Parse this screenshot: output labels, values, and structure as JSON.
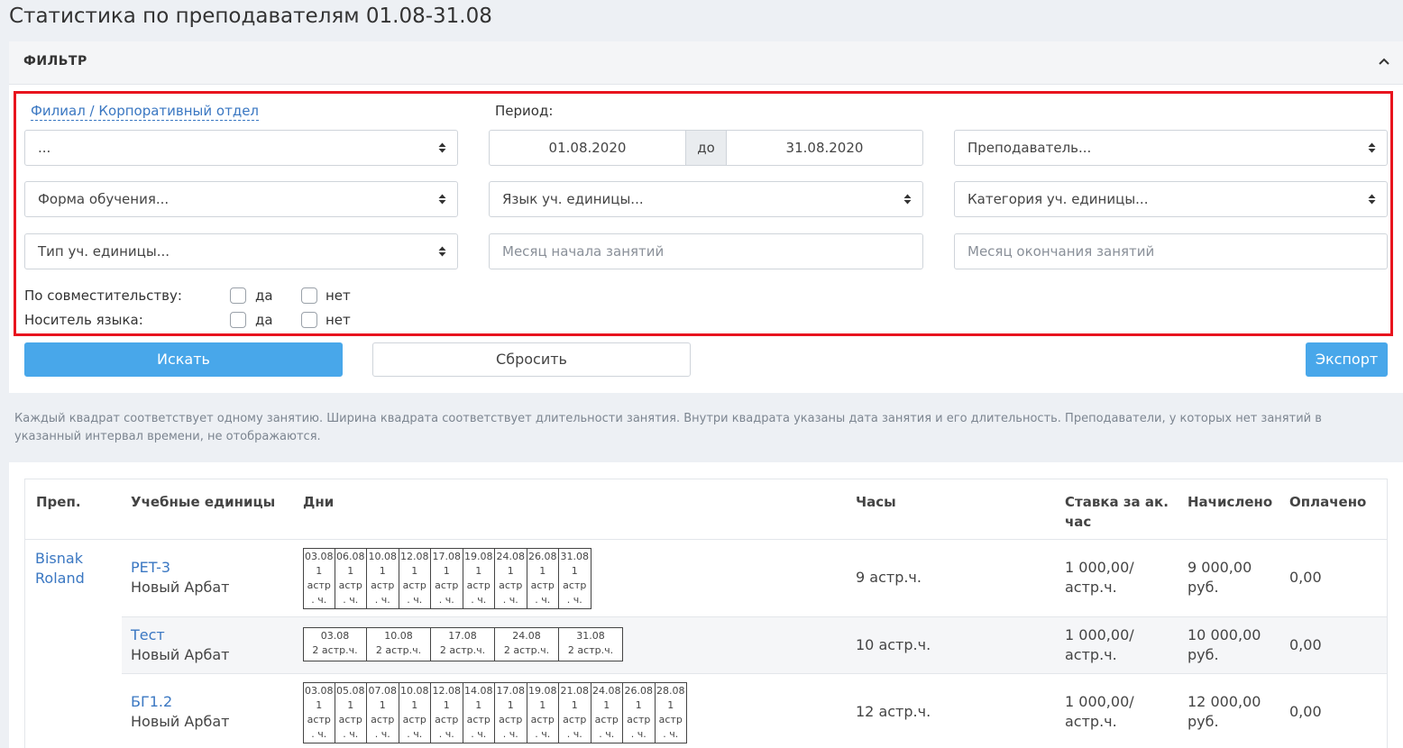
{
  "page_title": "Статистика по преподавателям 01.08-31.08",
  "filter": {
    "title": "ФИЛЬТР",
    "branch_link": "Филиал / Корпоративный отдел",
    "branch_value": "...",
    "period_label": "Период:",
    "date_from": "01.08.2020",
    "date_sep": "до",
    "date_to": "31.08.2020",
    "teacher": "Преподаватель...",
    "study_form": "Форма обучения...",
    "unit_language": "Язык уч. единицы...",
    "unit_category": "Категория уч. единицы...",
    "unit_type": "Тип уч. единицы...",
    "month_start_placeholder": "Месяц начала занятий",
    "month_end_placeholder": "Месяц окончания занятий",
    "part_time_label": "По совместительству:",
    "native_label": "Носитель языка:",
    "yes": "да",
    "no": "нет",
    "search_button": "Искать",
    "reset_button": "Сбросить",
    "export_button": "Экспорт"
  },
  "note": "Каждый квадрат соответствует одному занятию. Ширина квадрата соответствует длительности занятия. Внутри квадрата указаны дата занятия и его длительность. Преподаватели, у которых нет занятий в указанный интервал времени, не отображаются.",
  "table": {
    "headers": [
      "Преп.",
      "Учебные единицы",
      "Дни",
      "Часы",
      "Ставка за ак. час",
      "Начислено",
      "Оплачено"
    ],
    "teacher_first": "Bisnak",
    "teacher_last": "Roland",
    "rows": [
      {
        "unit": "PET-3",
        "branch": "Новый Арбат",
        "days": [
          "03.08",
          "06.08",
          "10.08",
          "12.08",
          "17.08",
          "19.08",
          "24.08",
          "26.08",
          "31.08"
        ],
        "day_duration": "1 астр. ч.",
        "hours": "9 астр.ч.",
        "rate_1": "1 000,00/",
        "rate_2": "астр.ч.",
        "accrued_1": "9 000,00",
        "accrued_2": "руб.",
        "paid": "0,00"
      },
      {
        "unit": "Тест",
        "branch": "Новый Арбат",
        "days": [
          "03.08",
          "10.08",
          "17.08",
          "24.08",
          "31.08"
        ],
        "day_duration": "2 астр.ч.",
        "hours": "10 астр.ч.",
        "rate_1": "1 000,00/",
        "rate_2": "астр.ч.",
        "accrued_1": "10 000,00",
        "accrued_2": "руб.",
        "paid": "0,00"
      },
      {
        "unit": "БГ1.2",
        "branch": "Новый Арбат",
        "days": [
          "03.08",
          "05.08",
          "07.08",
          "10.08",
          "12.08",
          "14.08",
          "17.08",
          "19.08",
          "21.08",
          "24.08",
          "26.08",
          "28.08"
        ],
        "day_duration": "1 астр. ч.",
        "hours": "12 астр.ч.",
        "rate_1": "1 000,00/",
        "rate_2": "астр.ч.",
        "accrued_1": "12 000,00",
        "accrued_2": "руб.",
        "paid": "0,00"
      }
    ]
  },
  "icons": {
    "collapse": "chevron-up-icon",
    "select_arrows": "sort-arrows-icon"
  },
  "colors": {
    "accent": "#48a7ea",
    "link": "#3a77c2",
    "highlight": "#e8141e"
  }
}
